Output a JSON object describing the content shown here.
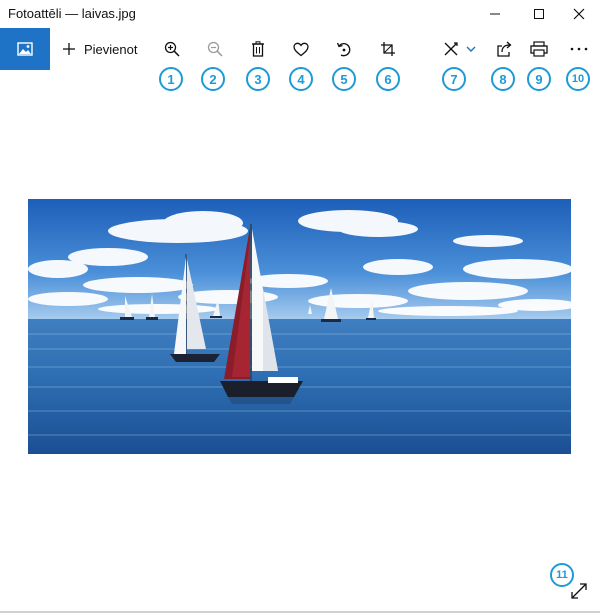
{
  "window": {
    "title": "Fotoattēli — laivas.jpg",
    "controls": [
      "minimize",
      "maximize",
      "close"
    ]
  },
  "toolbar": {
    "add_label": "Pievienot",
    "buttons": [
      {
        "icon": "zoom-in-icon",
        "badge": "1"
      },
      {
        "icon": "zoom-out-icon",
        "badge": "2"
      },
      {
        "icon": "trash-icon",
        "badge": "3"
      },
      {
        "icon": "heart-icon",
        "badge": "4"
      },
      {
        "icon": "rotate-icon",
        "badge": "5"
      },
      {
        "icon": "crop-icon",
        "badge": "6"
      },
      {
        "icon": "edit-draw-icon",
        "badge": "7"
      },
      {
        "icon": "share-icon",
        "badge": "8"
      },
      {
        "icon": "print-icon",
        "badge": "9"
      },
      {
        "icon": "more-icon",
        "badge": "10"
      }
    ]
  },
  "corner": {
    "icon": "expand-icon",
    "badge": "11"
  },
  "colors": {
    "accent": "#1e73c6",
    "badge": "#1e9ad6"
  }
}
